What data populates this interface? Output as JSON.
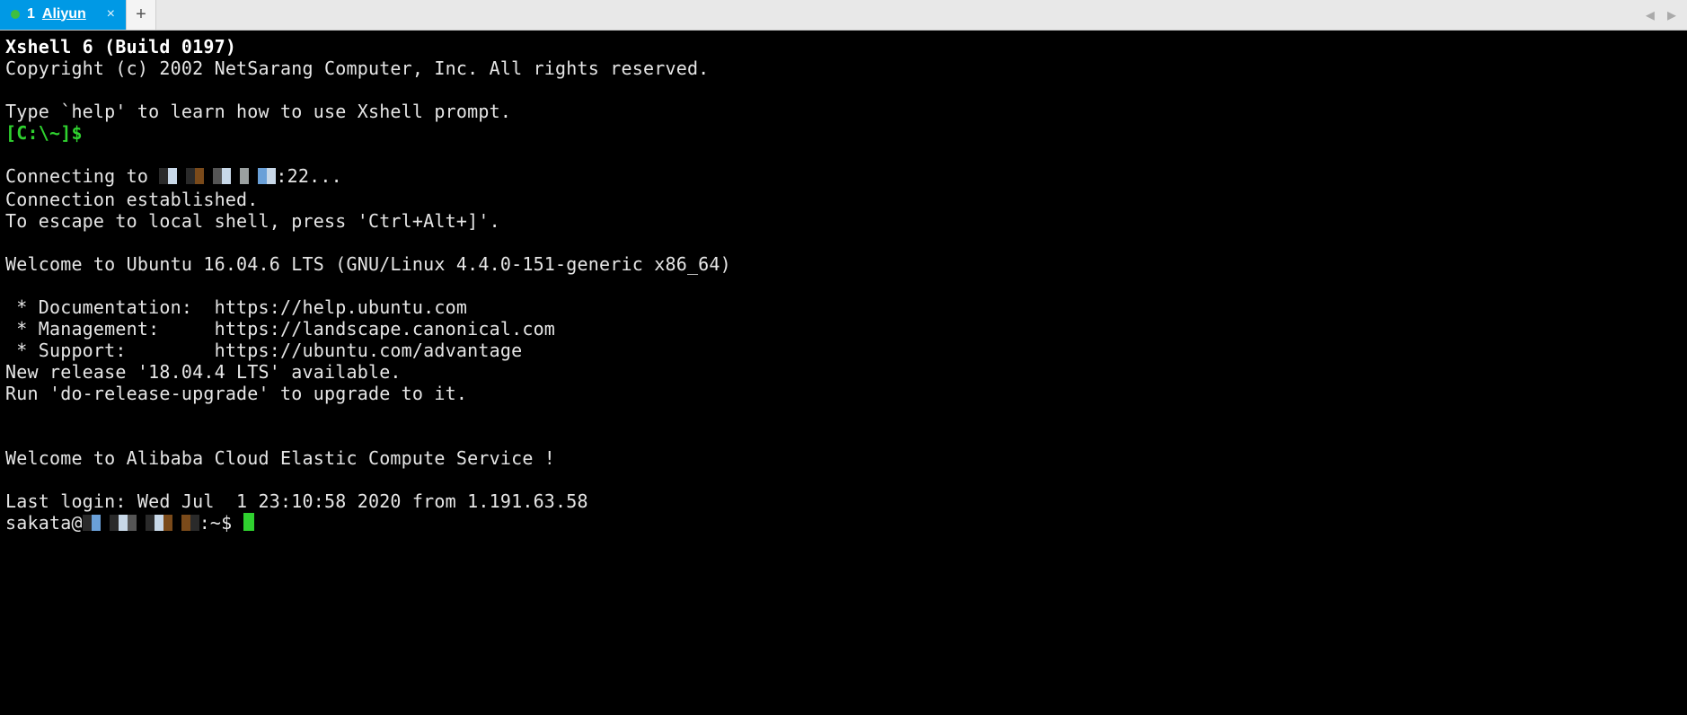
{
  "tab_bar": {
    "active_tab": {
      "index_label": "1",
      "title": "Aliyun",
      "close_label": "×"
    },
    "new_tab_label": "+",
    "scroll_left": "◂",
    "scroll_right": "▸"
  },
  "terminal": {
    "header_bold": "Xshell 6 (Build 0197)",
    "copyright": "Copyright (c) 2002 NetSarang Computer, Inc. All rights reserved.",
    "help_line": "Type `help' to learn how to use Xshell prompt.",
    "local_prompt": "[C:\\~]$",
    "connecting_prefix": "Connecting to ",
    "connecting_suffix": ":22...",
    "conn_established": "Connection established.",
    "escape_hint": "To escape to local shell, press 'Ctrl+Alt+]'.",
    "welcome_os": "Welcome to Ubuntu 16.04.6 LTS (GNU/Linux 4.4.0-151-generic x86_64)",
    "doc_line": " * Documentation:  https://help.ubuntu.com",
    "mgmt_line": " * Management:     https://landscape.canonical.com",
    "support_line": " * Support:        https://ubuntu.com/advantage",
    "new_release": "New release '18.04.4 LTS' available.",
    "upgrade_hint": "Run 'do-release-upgrade' to upgrade to it.",
    "welcome_ecs": "Welcome to Alibaba Cloud Elastic Compute Service !",
    "last_login": "Last login: Wed Jul  1 23:10:58 2020 from 1.191.63.58",
    "remote_prompt_user": "sakata@",
    "remote_prompt_suffix": ":~$ "
  }
}
